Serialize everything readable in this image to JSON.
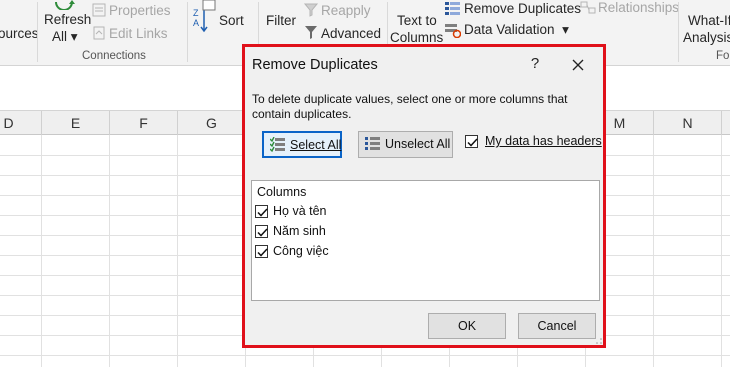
{
  "ribbon": {
    "sources_text": "ources",
    "refresh_label": "Refresh",
    "refresh_all_label": "All",
    "properties_label": "Properties",
    "edit_links_label": "Edit Links",
    "connections_group": "Connections",
    "sort_label": "Sort",
    "filter_label": "Filter",
    "reapply_label": "Reapply",
    "advanced_label": "Advanced",
    "text_to_label": "Text to",
    "columns_label": "Columns",
    "remove_duplicates_label": "Remove Duplicates",
    "data_validation_label": "Data Validation",
    "relationships_label": "Relationships",
    "what_if_label": "What-If",
    "analysis_label": "Analysis",
    "fo_label": "Fo"
  },
  "grid": {
    "column_headers": [
      "D",
      "E",
      "F",
      "G",
      "",
      "",
      "",
      "",
      "",
      "M",
      "N"
    ]
  },
  "dialog": {
    "title": "Remove Duplicates",
    "help": "?",
    "description": "To delete duplicate values, select one or more columns that contain duplicates.",
    "select_all_label": "Select All",
    "unselect_all_label": "Unselect All",
    "my_data_has_headers_label": "My data has headers",
    "my_data_has_headers_checked": true,
    "columns_heading": "Columns",
    "columns": [
      {
        "label": "Họ và tên",
        "checked": true
      },
      {
        "label": "Năm sinh",
        "checked": true
      },
      {
        "label": "Công việc",
        "checked": true
      }
    ],
    "ok_label": "OK",
    "cancel_label": "Cancel"
  },
  "colors": {
    "highlight_border": "#e0101a",
    "focus_border": "#0a64c8",
    "ribbon_bg": "#f3f3f3",
    "dialog_bg": "#f0f0f0"
  }
}
